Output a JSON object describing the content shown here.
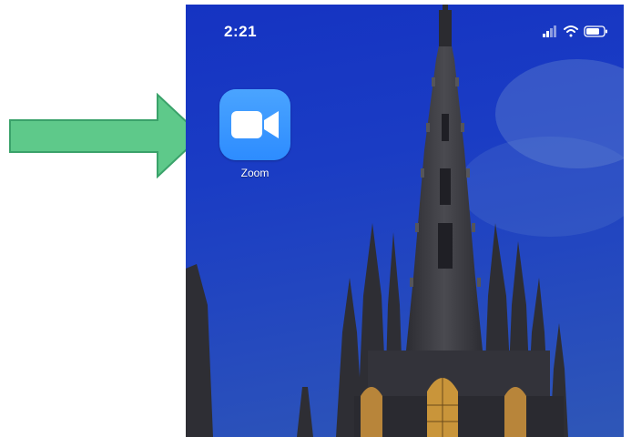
{
  "status_bar": {
    "time": "2:21",
    "icons": [
      "signal-icon",
      "wifi-icon",
      "battery-icon"
    ]
  },
  "home_screen": {
    "apps": [
      {
        "label": "Zoom",
        "icon": "zoom-camera-icon",
        "color": "#2d8cff"
      }
    ]
  },
  "annotation": {
    "type": "arrow",
    "color": "#5ec98a",
    "border_color": "#3aa26a",
    "points_to": "Zoom"
  },
  "wallpaper": {
    "subject": "cathedral-spire-icon",
    "sky_color": "#1a3cc4"
  }
}
